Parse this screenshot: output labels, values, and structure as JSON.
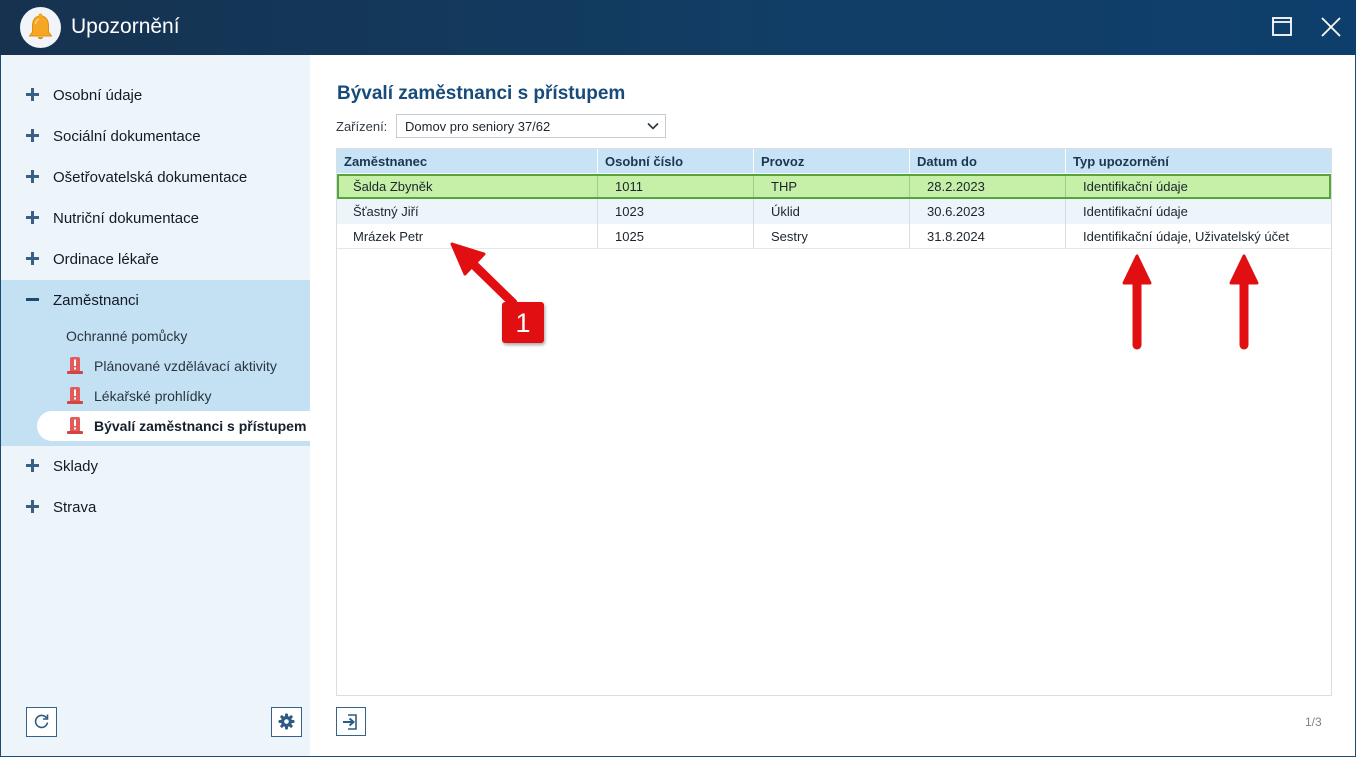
{
  "window": {
    "title": "Upozornění",
    "icon": "bell-icon",
    "maximize_icon": "maximize-icon",
    "close_icon": "close-icon"
  },
  "sidebar": {
    "groups": [
      {
        "label": "Osobní údaje",
        "state": "collapsed"
      },
      {
        "label": "Sociální dokumentace",
        "state": "collapsed"
      },
      {
        "label": "Ošetřovatelská dokumentace",
        "state": "collapsed"
      },
      {
        "label": "Nutriční dokumentace",
        "state": "collapsed"
      },
      {
        "label": "Ordinace lékaře",
        "state": "collapsed"
      },
      {
        "label": "Zaměstnanci",
        "state": "expanded"
      },
      {
        "label": "Sklady",
        "state": "collapsed"
      },
      {
        "label": "Strava",
        "state": "collapsed"
      }
    ],
    "zamestnanci_items": [
      {
        "label": "Ochranné pomůcky",
        "alert": false,
        "active": false
      },
      {
        "label": "Plánované vzdělávací aktivity",
        "alert": true,
        "active": false
      },
      {
        "label": "Lékařské prohlídky",
        "alert": true,
        "active": false
      },
      {
        "label": "Bývalí zaměstnanci s přístupem",
        "alert": true,
        "active": true
      }
    ],
    "refresh_icon": "refresh-icon",
    "settings_icon": "gear-icon"
  },
  "main": {
    "title": "Bývalí zaměstnanci s přístupem",
    "filter": {
      "label": "Zařízení:",
      "value": "Domov pro seniory 37/62"
    },
    "table": {
      "columns": [
        "Zaměstnanec",
        "Osobní číslo",
        "Provoz",
        "Datum do",
        "Typ upozornění"
      ],
      "rows": [
        {
          "zamestnanec": "Šalda Zbyněk",
          "osobni_cislo": "1011",
          "provoz": "THP",
          "datum_do": "28.2.2023",
          "typ": "Identifikační údaje",
          "selected": true
        },
        {
          "zamestnanec": "Šťastný Jiří",
          "osobni_cislo": "1023",
          "provoz": "Úklid",
          "datum_do": "30.6.2023",
          "typ": "Identifikační údaje",
          "selected": false
        },
        {
          "zamestnanec": "Mrázek Petr",
          "osobni_cislo": "1025",
          "provoz": "Sestry",
          "datum_do": "31.8.2024",
          "typ": "Identifikační údaje, Uživatelský účet",
          "selected": false
        }
      ]
    },
    "export_icon": "export-icon",
    "pager": "1/3"
  },
  "annotations": {
    "badge": "1",
    "color": "#e10f12"
  }
}
